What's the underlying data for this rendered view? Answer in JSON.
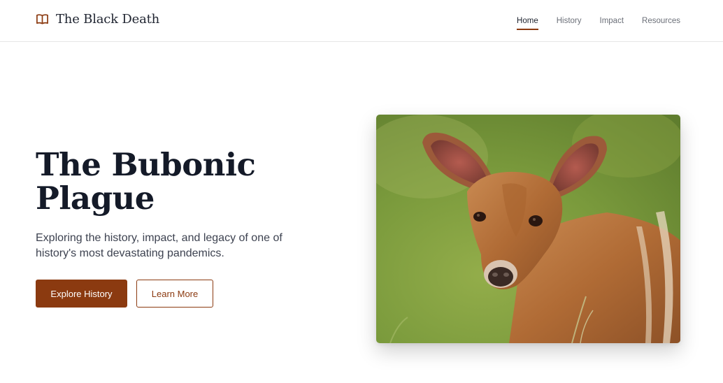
{
  "brand": {
    "title": "The Black Death",
    "icon": "book-icon",
    "accent": "#8b3a10"
  },
  "nav": {
    "items": [
      {
        "label": "Home",
        "active": true
      },
      {
        "label": "History",
        "active": false
      },
      {
        "label": "Impact",
        "active": false
      },
      {
        "label": "Resources",
        "active": false
      }
    ]
  },
  "hero": {
    "title_line1": "The Bubonic",
    "title_line2": "Plague",
    "subtitle": "Exploring the history, impact, and legacy of one of history's most devastating pandemics.",
    "primary_button": "Explore History",
    "secondary_button": "Learn More"
  },
  "image": {
    "subject": "young deer fawn in green grass"
  }
}
